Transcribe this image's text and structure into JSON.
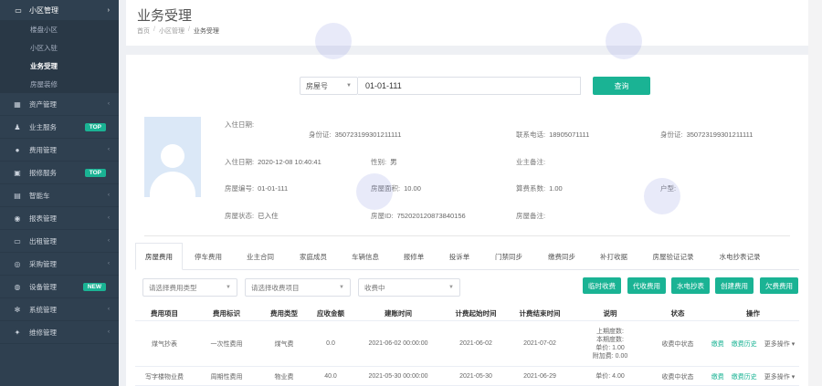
{
  "sidebar": {
    "section": {
      "label": "小区管理",
      "icon": "monitor-icon"
    },
    "subitems": [
      {
        "label": "楼盘小区",
        "active": false
      },
      {
        "label": "小区入驻",
        "active": false
      },
      {
        "label": "业务受理",
        "active": true
      },
      {
        "label": "房屋装修",
        "active": false
      }
    ],
    "items": [
      {
        "label": "资产管理",
        "icon": "grid-icon",
        "badge": ""
      },
      {
        "label": "业主服务",
        "icon": "user-icon",
        "badge": "TOP"
      },
      {
        "label": "费用管理",
        "icon": "coin-icon",
        "badge": ""
      },
      {
        "label": "报修服务",
        "icon": "repair-icon",
        "badge": "TOP"
      },
      {
        "label": "智能车",
        "icon": "car-icon",
        "badge": ""
      },
      {
        "label": "报表管理",
        "icon": "chart-icon",
        "badge": ""
      },
      {
        "label": "出租管理",
        "icon": "desktop-icon",
        "badge": ""
      },
      {
        "label": "采购管理",
        "icon": "cart-icon",
        "badge": ""
      },
      {
        "label": "设备管理",
        "icon": "device-icon",
        "badge": "NEW"
      },
      {
        "label": "系统管理",
        "icon": "gear-icon",
        "badge": ""
      },
      {
        "label": "维修管理",
        "icon": "wrench-icon",
        "badge": ""
      }
    ]
  },
  "header": {
    "title": "业务受理",
    "breadcrumb": [
      "首页",
      "小区管理",
      "业务受理"
    ]
  },
  "search": {
    "type_label": "房屋号",
    "value": "01-01-111",
    "query_label": "查询"
  },
  "resident": {
    "row1": [
      {
        "label": "入住日期:",
        "value": ""
      },
      {
        "label": "身份证:",
        "value": "350723199301211111"
      },
      {
        "label": "联系电话:",
        "value": "18905071111"
      },
      {
        "label": "身份证:",
        "value": "350723199301211111"
      }
    ],
    "row2": [
      {
        "label": "入住日期:",
        "value": "2020-12-08 10:40:41"
      },
      {
        "label": "性别:",
        "value": "男"
      },
      {
        "label": "业主备注:",
        "value": ""
      }
    ],
    "row3": [
      {
        "label": "房屋编号:",
        "value": "01-01-111"
      },
      {
        "label": "房屋面积:",
        "value": "10.00"
      },
      {
        "label": "算费系数:",
        "value": "1.00"
      },
      {
        "label": "户型:",
        "value": ""
      }
    ],
    "row4": [
      {
        "label": "房屋状态:",
        "value": "已入住"
      },
      {
        "label": "房屋ID:",
        "value": "752020120873840156"
      },
      {
        "label": "房屋备注:",
        "value": ""
      }
    ]
  },
  "tabs": [
    "房屋费用",
    "停车费用",
    "业主合同",
    "家庭成员",
    "车辆信息",
    "报修单",
    "投诉单",
    "门禁同步",
    "缴费同步",
    "补打收据",
    "房屋验证记录",
    "水电抄表记录"
  ],
  "filters": {
    "fee_type_placeholder": "请选择费用类型",
    "fee_item_placeholder": "请选择收费项目",
    "status_value": "收费中"
  },
  "action_buttons": [
    "临时收费",
    "代收费用",
    "水电抄表",
    "创建费用",
    "欠费费用"
  ],
  "table": {
    "headers": [
      "费用项目",
      "费用标识",
      "费用类型",
      "应收金额",
      "建账时间",
      "计费起始时间",
      "计费结束时间",
      "说明",
      "状态",
      "操作"
    ],
    "rows": [
      {
        "item": "煤气抄表",
        "flag": "一次性费用",
        "type": "煤气费",
        "amount": "0.0",
        "created": "2021-06-02 00:00:00",
        "start": "2021-06-02",
        "end": "2021-07-02",
        "notes": [
          "上期度数:",
          "本期度数:",
          "单价: 1.00",
          "附加费: 0.00"
        ],
        "status": "收费中状态",
        "ops": [
          "缴费",
          "缴费历史",
          "更多操作 ▾"
        ]
      },
      {
        "item": "写字楼物业费",
        "flag": "周期性费用",
        "type": "物业费",
        "amount": "40.0",
        "created": "2021-05-30 00:00:00",
        "start": "2021-05-30",
        "end": "2021-06-29",
        "notes": [
          "单价: 4.00"
        ],
        "status": "收费中状态",
        "ops": [
          "缴费",
          "缴费历史",
          "更多操作 ▾"
        ]
      }
    ]
  },
  "colors": {
    "accent": "#1ab394",
    "sidebar": "#2f4050"
  }
}
